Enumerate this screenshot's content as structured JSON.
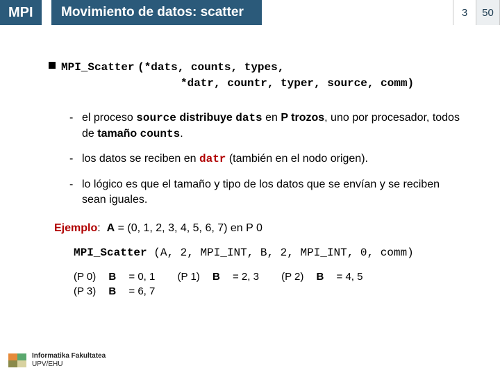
{
  "header": {
    "prefix": "MPI",
    "title": "Movimiento de datos: scatter",
    "page_current": "3",
    "page_total": "50"
  },
  "sig": {
    "fn": "MPI_Scatter",
    "args1_open": "(",
    "args1": "*dats, counts, types,",
    "args2": "*datr, countr, typer, source, comm)"
  },
  "bullets": {
    "dash": "-",
    "b1_pre": "el proceso ",
    "b1_src": "source",
    "b1_dist": " distribuye ",
    "b1_dats": "dats",
    "b1_mid": " en ",
    "b1_ptro": "P trozos",
    "b1_post": ", uno por procesador, todos de ",
    "b1_tam": "tamaño ",
    "b1_counts": "counts",
    "b1_dot": ".",
    "b2_pre": "los datos se reciben en ",
    "b2_datr": "datr",
    "b2_post": " (también en el nodo origen).",
    "b3": "lo lógico es que el tamaño y tipo de los datos que se envían y se reciben sean iguales."
  },
  "ejemplo": {
    "label": "Ejemplo",
    "colon": ":",
    "setup_a": "A",
    "setup_eq": " = (0, 1, 2, 3, 4, 5, 6, 7) en P 0",
    "call_fn": "MPI_Scatter",
    "call_open": "(",
    "call_args": "A, 2, MPI_INT,  B, 2, MPI_INT,  0,  comm)",
    "r0_p": "(P 0) ",
    "r0_b": "B",
    "r0_v": " = 0, 1",
    "r1_p": "(P 1) ",
    "r1_b": "B",
    "r1_v": " = 2, 3",
    "r2_p": "(P 2) ",
    "r2_b": "B",
    "r2_v": " = 4, 5",
    "r3_p": "(P 3) ",
    "r3_b": "B",
    "r3_v": " = 6, 7"
  },
  "footer": {
    "line1": "Informatika Fakultatea",
    "line2": "UPV/EHU"
  }
}
